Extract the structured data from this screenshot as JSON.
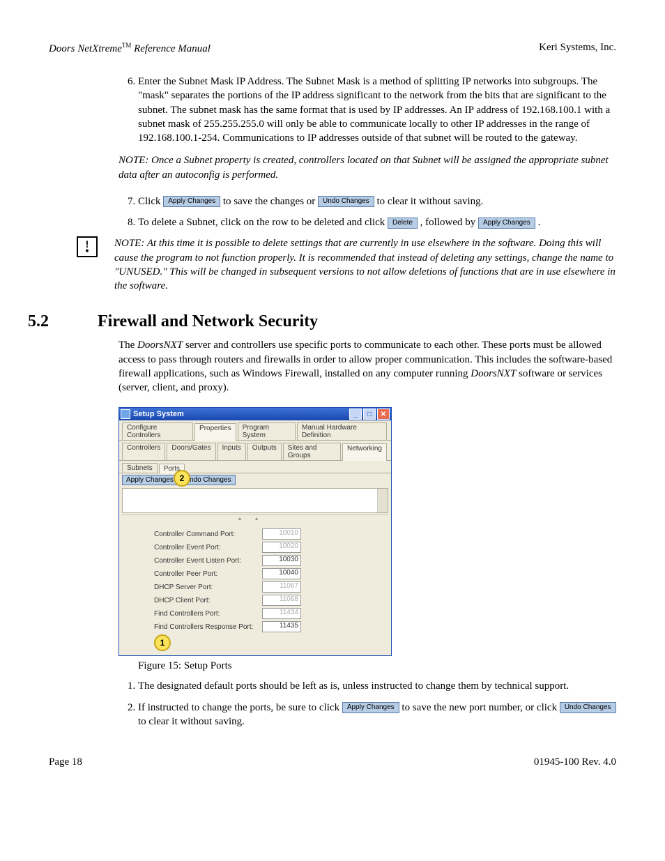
{
  "header": {
    "product": "Doors NetXtreme",
    "tm": "TM",
    "doc": " Reference Manual",
    "company": "Keri Systems, Inc."
  },
  "steps_a": {
    "s6": "Enter the Subnet Mask IP Address. The Subnet Mask is a method of splitting IP networks into subgroups. The \"mask\" separates the portions of the IP address significant to the network from the bits that are significant to the subnet. The subnet mask has the same format that is used by IP addresses. An IP address of 192.168.100.1 with a subnet mask of 255.255.255.0 will only be able to communicate locally to other IP addresses in the range of 192.168.100.1-254. Communications to IP addresses outside of that subnet will be routed to the gateway."
  },
  "note1": "NOTE: Once a Subnet property is created, controllers located on that Subnet will be assigned the appropriate subnet data after an autoconfig is performed.",
  "steps_b": {
    "s7a": "Click ",
    "apply": "Apply Changes",
    "s7b": " to save the changes or ",
    "undo": "Undo Changes",
    "s7c": " to clear it without saving.",
    "s8a": "To delete a Subnet, click on the row to be deleted and click ",
    "delete": "Delete",
    "s8b": ", followed by ",
    "s8c": "."
  },
  "note2": "NOTE: At this time it is possible to delete settings that are currently in use elsewhere in the software. Doing this will cause the program to not function properly. It is recommended that instead of deleting any settings, change the name to \"UNUSED.\" This will be changed in subsequent versions to not allow deletions of functions that are in use elsewhere in the software.",
  "section": {
    "num": "5.2",
    "title": "Firewall and Network Security"
  },
  "para1a": "The ",
  "para1b": "DoorsNXT",
  "para1c": " server and controllers use specific ports to communicate to each other. These ports must be allowed access to pass through routers and firewalls in order to allow proper communication. This includes the software-based firewall applications, such as Windows Firewall, installed on any computer running ",
  "para1d": "DoorsNXT",
  "para1e": " software or services (server, client, and proxy).",
  "win": {
    "title": "Setup System",
    "tabs1": [
      "Configure Controllers",
      "Properties",
      "Program System",
      "Manual Hardware Definition"
    ],
    "tabs2": [
      "Controllers",
      "Doors/Gates",
      "Inputs",
      "Outputs",
      "Sites and Groups",
      "Networking"
    ],
    "tabs3": [
      "Subnets",
      "Ports"
    ],
    "btns": {
      "apply": "Apply Changes",
      "undo": "Undo Changes"
    },
    "rows": [
      {
        "label": "Controller Command Port:",
        "val": "10010",
        "dim": true
      },
      {
        "label": "Controller Event Port:",
        "val": "10020",
        "dim": true
      },
      {
        "label": "Controller Event Listen Port:",
        "val": "10030",
        "dim": false
      },
      {
        "label": "Controller Peer Port:",
        "val": "10040",
        "dim": false
      },
      {
        "label": "DHCP Server Port:",
        "val": "11067",
        "dim": true
      },
      {
        "label": "DHCP Client Port:",
        "val": "11068",
        "dim": true
      },
      {
        "label": "Find Controllers Port:",
        "val": "11434",
        "dim": true
      },
      {
        "label": "Find Controllers Response Port:",
        "val": "11435",
        "dim": false
      }
    ],
    "markers": {
      "m1": "1",
      "m2": "2"
    }
  },
  "fig_caption": "Figure 15: Setup Ports",
  "steps_c": {
    "s1": "The designated default ports should be left as is, unless instructed to change them by technical support.",
    "s2a": "If instructed to change the ports, be sure to click ",
    "s2b": " to save the new port number, or click ",
    "s2c": " to clear it without saving."
  },
  "footer": {
    "page": "Page 18",
    "doc": "01945-100  Rev. 4.0"
  }
}
